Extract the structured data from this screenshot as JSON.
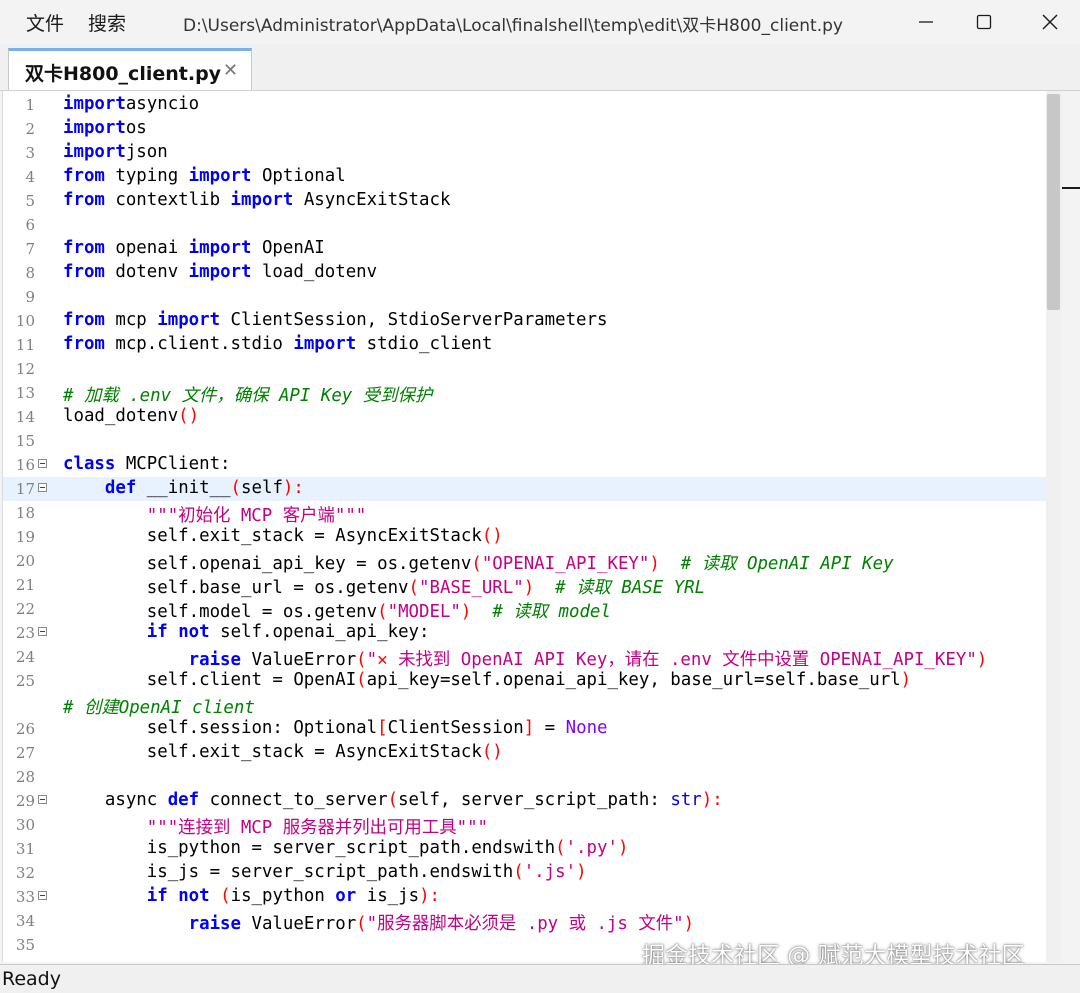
{
  "menu": {
    "file": "文件",
    "search": "搜索"
  },
  "window_title": "D:\\Users\\Administrator\\AppData\\Local\\finalshell\\temp\\edit\\双卡H800_client.py",
  "tab": {
    "label": "双卡H800_client.py"
  },
  "status": {
    "text": "Ready"
  },
  "watermark": "掘金技术社区 @ 赋范大模型技术社区",
  "current_line": 17,
  "code_lines": [
    {
      "n": "1",
      "segs": [
        [
          "kw",
          "import"
        ],
        [
          "",
          "asyncio"
        ]
      ]
    },
    {
      "n": "2",
      "segs": [
        [
          "kw",
          "import"
        ],
        [
          "",
          "os"
        ]
      ]
    },
    {
      "n": "3",
      "segs": [
        [
          "kw",
          "import"
        ],
        [
          "",
          "json"
        ]
      ]
    },
    {
      "n": "4",
      "segs": [
        [
          "kw",
          "from"
        ],
        [
          "",
          " typing "
        ],
        [
          "kw",
          "import"
        ],
        [
          "",
          " Optional"
        ]
      ]
    },
    {
      "n": "5",
      "segs": [
        [
          "kw",
          "from"
        ],
        [
          "",
          " contextlib "
        ],
        [
          "kw",
          "import"
        ],
        [
          "",
          " AsyncExitStack"
        ]
      ]
    },
    {
      "n": "6",
      "segs": []
    },
    {
      "n": "7",
      "segs": [
        [
          "kw",
          "from"
        ],
        [
          "",
          " openai "
        ],
        [
          "kw",
          "import"
        ],
        [
          "",
          " OpenAI"
        ]
      ]
    },
    {
      "n": "8",
      "segs": [
        [
          "kw",
          "from"
        ],
        [
          "",
          " dotenv "
        ],
        [
          "kw",
          "import"
        ],
        [
          "",
          " load_dotenv"
        ]
      ]
    },
    {
      "n": "9",
      "segs": []
    },
    {
      "n": "10",
      "segs": [
        [
          "kw",
          "from"
        ],
        [
          "",
          " mcp "
        ],
        [
          "kw",
          "import"
        ],
        [
          "",
          " ClientSession, StdioServerParameters"
        ]
      ]
    },
    {
      "n": "11",
      "segs": [
        [
          "kw",
          "from"
        ],
        [
          "",
          " mcp.client.stdio "
        ],
        [
          "kw",
          "import"
        ],
        [
          "",
          " stdio_client"
        ]
      ]
    },
    {
      "n": "12",
      "segs": []
    },
    {
      "n": "13",
      "segs": [
        [
          "cmt",
          "# 加载 .env 文件，确保 API Key 受到保护"
        ]
      ]
    },
    {
      "n": "14",
      "segs": [
        [
          "",
          "load_dotenv"
        ],
        [
          "par",
          "()"
        ]
      ]
    },
    {
      "n": "15",
      "segs": []
    },
    {
      "n": "16",
      "fold": true,
      "segs": [
        [
          "kw",
          "class"
        ],
        [
          "",
          " MCPClient:"
        ]
      ]
    },
    {
      "n": "17",
      "fold": true,
      "segs": [
        [
          "",
          "    "
        ],
        [
          "kw",
          "def"
        ],
        [
          "",
          " __init__"
        ],
        [
          "par",
          "("
        ],
        [
          "",
          "self"
        ],
        [
          "par",
          "):"
        ]
      ]
    },
    {
      "n": "18",
      "segs": [
        [
          "",
          "        "
        ],
        [
          "str",
          "\"\"\"初始化 MCP 客户端\"\"\""
        ]
      ]
    },
    {
      "n": "19",
      "segs": [
        [
          "",
          "        self.exit_stack = AsyncExitStack"
        ],
        [
          "par",
          "()"
        ]
      ]
    },
    {
      "n": "20",
      "segs": [
        [
          "",
          "        self.openai_api_key = os.getenv"
        ],
        [
          "par",
          "("
        ],
        [
          "str",
          "\"OPENAI_API_KEY\""
        ],
        [
          "par",
          ")"
        ],
        [
          "",
          "  "
        ],
        [
          "cmt",
          "# 读取 OpenAI API Key"
        ]
      ]
    },
    {
      "n": "21",
      "segs": [
        [
          "",
          "        self.base_url = os.getenv"
        ],
        [
          "par",
          "("
        ],
        [
          "str",
          "\"BASE_URL\""
        ],
        [
          "par",
          ")"
        ],
        [
          "",
          "  "
        ],
        [
          "cmt",
          "# 读取 BASE YRL"
        ]
      ]
    },
    {
      "n": "22",
      "segs": [
        [
          "",
          "        self.model = os.getenv"
        ],
        [
          "par",
          "("
        ],
        [
          "str",
          "\"MODEL\""
        ],
        [
          "par",
          ")"
        ],
        [
          "",
          "  "
        ],
        [
          "cmt",
          "# 读取 model"
        ]
      ]
    },
    {
      "n": "23",
      "fold": true,
      "segs": [
        [
          "",
          "        "
        ],
        [
          "kw",
          "if"
        ],
        [
          "",
          " "
        ],
        [
          "kw",
          "not"
        ],
        [
          "",
          " self.openai_api_key:"
        ]
      ]
    },
    {
      "n": "24",
      "segs": [
        [
          "",
          "            "
        ],
        [
          "kw",
          "raise"
        ],
        [
          "",
          " ValueError"
        ],
        [
          "par",
          "("
        ],
        [
          "str",
          "\""
        ],
        [
          "par",
          "✕"
        ],
        [
          "str",
          " 未找到 OpenAI API Key，请在 .env 文件中设置 OPENAI_API_KEY\""
        ],
        [
          "par",
          ")"
        ]
      ]
    },
    {
      "n": "25",
      "segs": [
        [
          "",
          "        self.client = OpenAI"
        ],
        [
          "par",
          "("
        ],
        [
          "",
          "api_key=self.openai_api_key, base_url=self.base_url"
        ],
        [
          "par",
          ")"
        ]
      ]
    },
    {
      "n": "",
      "wrap": true,
      "segs": [
        [
          "cmt",
          "# 创建OpenAI client"
        ]
      ]
    },
    {
      "n": "26",
      "segs": [
        [
          "",
          "        self.session: Optional"
        ],
        [
          "par",
          "["
        ],
        [
          "",
          "ClientSession"
        ],
        [
          "par",
          "]"
        ],
        [
          "",
          " = "
        ],
        [
          "bi",
          "None"
        ]
      ]
    },
    {
      "n": "27",
      "segs": [
        [
          "",
          "        self.exit_stack = AsyncExitStack"
        ],
        [
          "par",
          "()"
        ]
      ]
    },
    {
      "n": "28",
      "segs": []
    },
    {
      "n": "29",
      "fold": true,
      "segs": [
        [
          "",
          "    async "
        ],
        [
          "kw",
          "def"
        ],
        [
          "",
          " connect_to_server"
        ],
        [
          "par",
          "("
        ],
        [
          "",
          "self, server_script_path: "
        ],
        [
          "kw2",
          "str"
        ],
        [
          "par",
          "):"
        ]
      ]
    },
    {
      "n": "30",
      "segs": [
        [
          "",
          "        "
        ],
        [
          "str",
          "\"\"\"连接到 MCP 服务器并列出可用工具\"\"\""
        ]
      ]
    },
    {
      "n": "31",
      "segs": [
        [
          "",
          "        is_python = server_script_path.endswith"
        ],
        [
          "par",
          "("
        ],
        [
          "str",
          "'.py'"
        ],
        [
          "par",
          ")"
        ]
      ]
    },
    {
      "n": "32",
      "segs": [
        [
          "",
          "        is_js = server_script_path.endswith"
        ],
        [
          "par",
          "("
        ],
        [
          "str",
          "'.js'"
        ],
        [
          "par",
          ")"
        ]
      ]
    },
    {
      "n": "33",
      "fold": true,
      "segs": [
        [
          "",
          "        "
        ],
        [
          "kw",
          "if"
        ],
        [
          "",
          " "
        ],
        [
          "kw",
          "not"
        ],
        [
          "",
          " "
        ],
        [
          "par",
          "("
        ],
        [
          "",
          "is_python "
        ],
        [
          "kw",
          "or"
        ],
        [
          "",
          " is_js"
        ],
        [
          "par",
          "):"
        ]
      ]
    },
    {
      "n": "34",
      "segs": [
        [
          "",
          "            "
        ],
        [
          "kw",
          "raise"
        ],
        [
          "",
          " ValueError"
        ],
        [
          "par",
          "("
        ],
        [
          "str",
          "\"服务器脚本必须是 .py 或 .js 文件\""
        ],
        [
          "par",
          ")"
        ]
      ]
    },
    {
      "n": "35",
      "segs": []
    }
  ]
}
